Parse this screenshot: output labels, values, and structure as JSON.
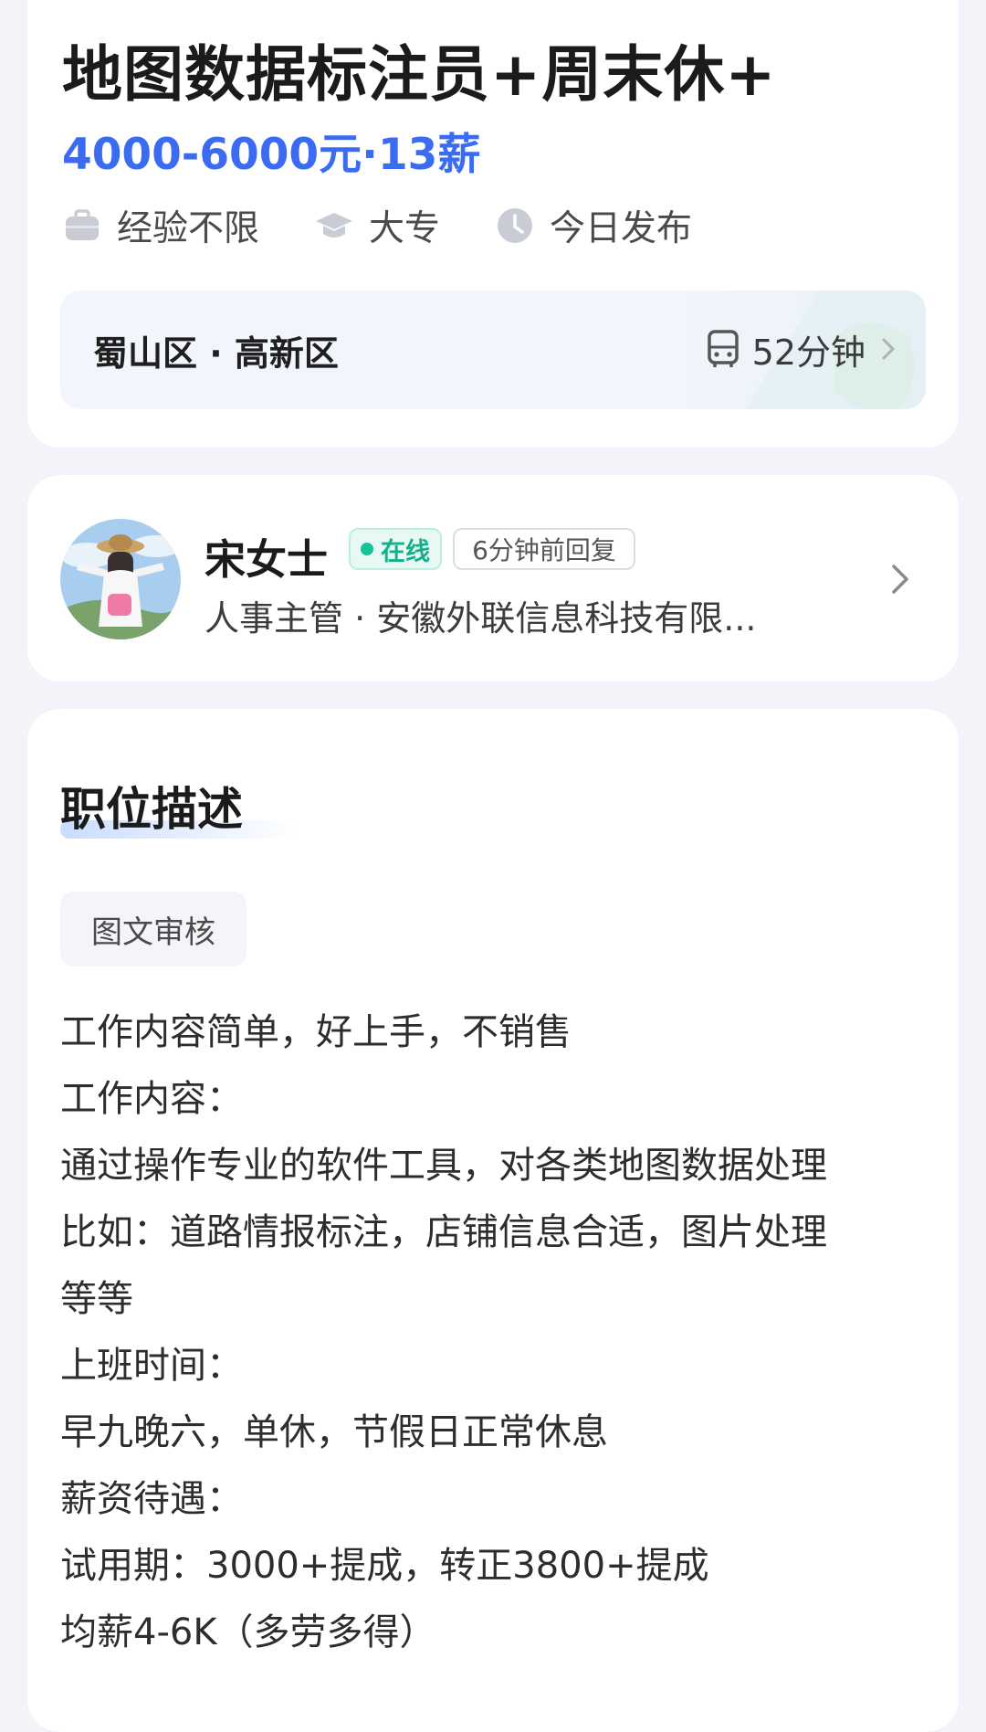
{
  "job": {
    "title": "地图数据标注员+周末休+",
    "salary": "4000-6000元·13薪",
    "tags": [
      {
        "icon": "briefcase-icon",
        "label": "经验不限"
      },
      {
        "icon": "graduation-cap-icon",
        "label": "大专"
      },
      {
        "icon": "clock-icon",
        "label": "今日发布"
      }
    ],
    "location": "蜀山区 · 高新区",
    "commute": "52分钟"
  },
  "recruiter": {
    "name": "宋女士",
    "online": "在线",
    "reply": "6分钟前回复",
    "subtitle": "人事主管 · 安徽外联信息科技有限..."
  },
  "description": {
    "title": "职位描述",
    "skill_tag": "图文审核",
    "lines": [
      "工作内容简单，好上手，不销售",
      "工作内容：",
      "通过操作专业的软件工具，对各类地图数据处理",
      "比如：道路情报标注，店铺信息合适，图片处理",
      "等等",
      "上班时间：",
      "早九晚六，单休，节假日正常休息",
      "薪资待遇：",
      "试用期：3000+提成，转正3800+提成",
      "均薪4-6K（多劳多得）"
    ]
  },
  "colors": {
    "salary": "#3a6bf1",
    "online": "#14c39a",
    "background": "#f2f4f9"
  }
}
